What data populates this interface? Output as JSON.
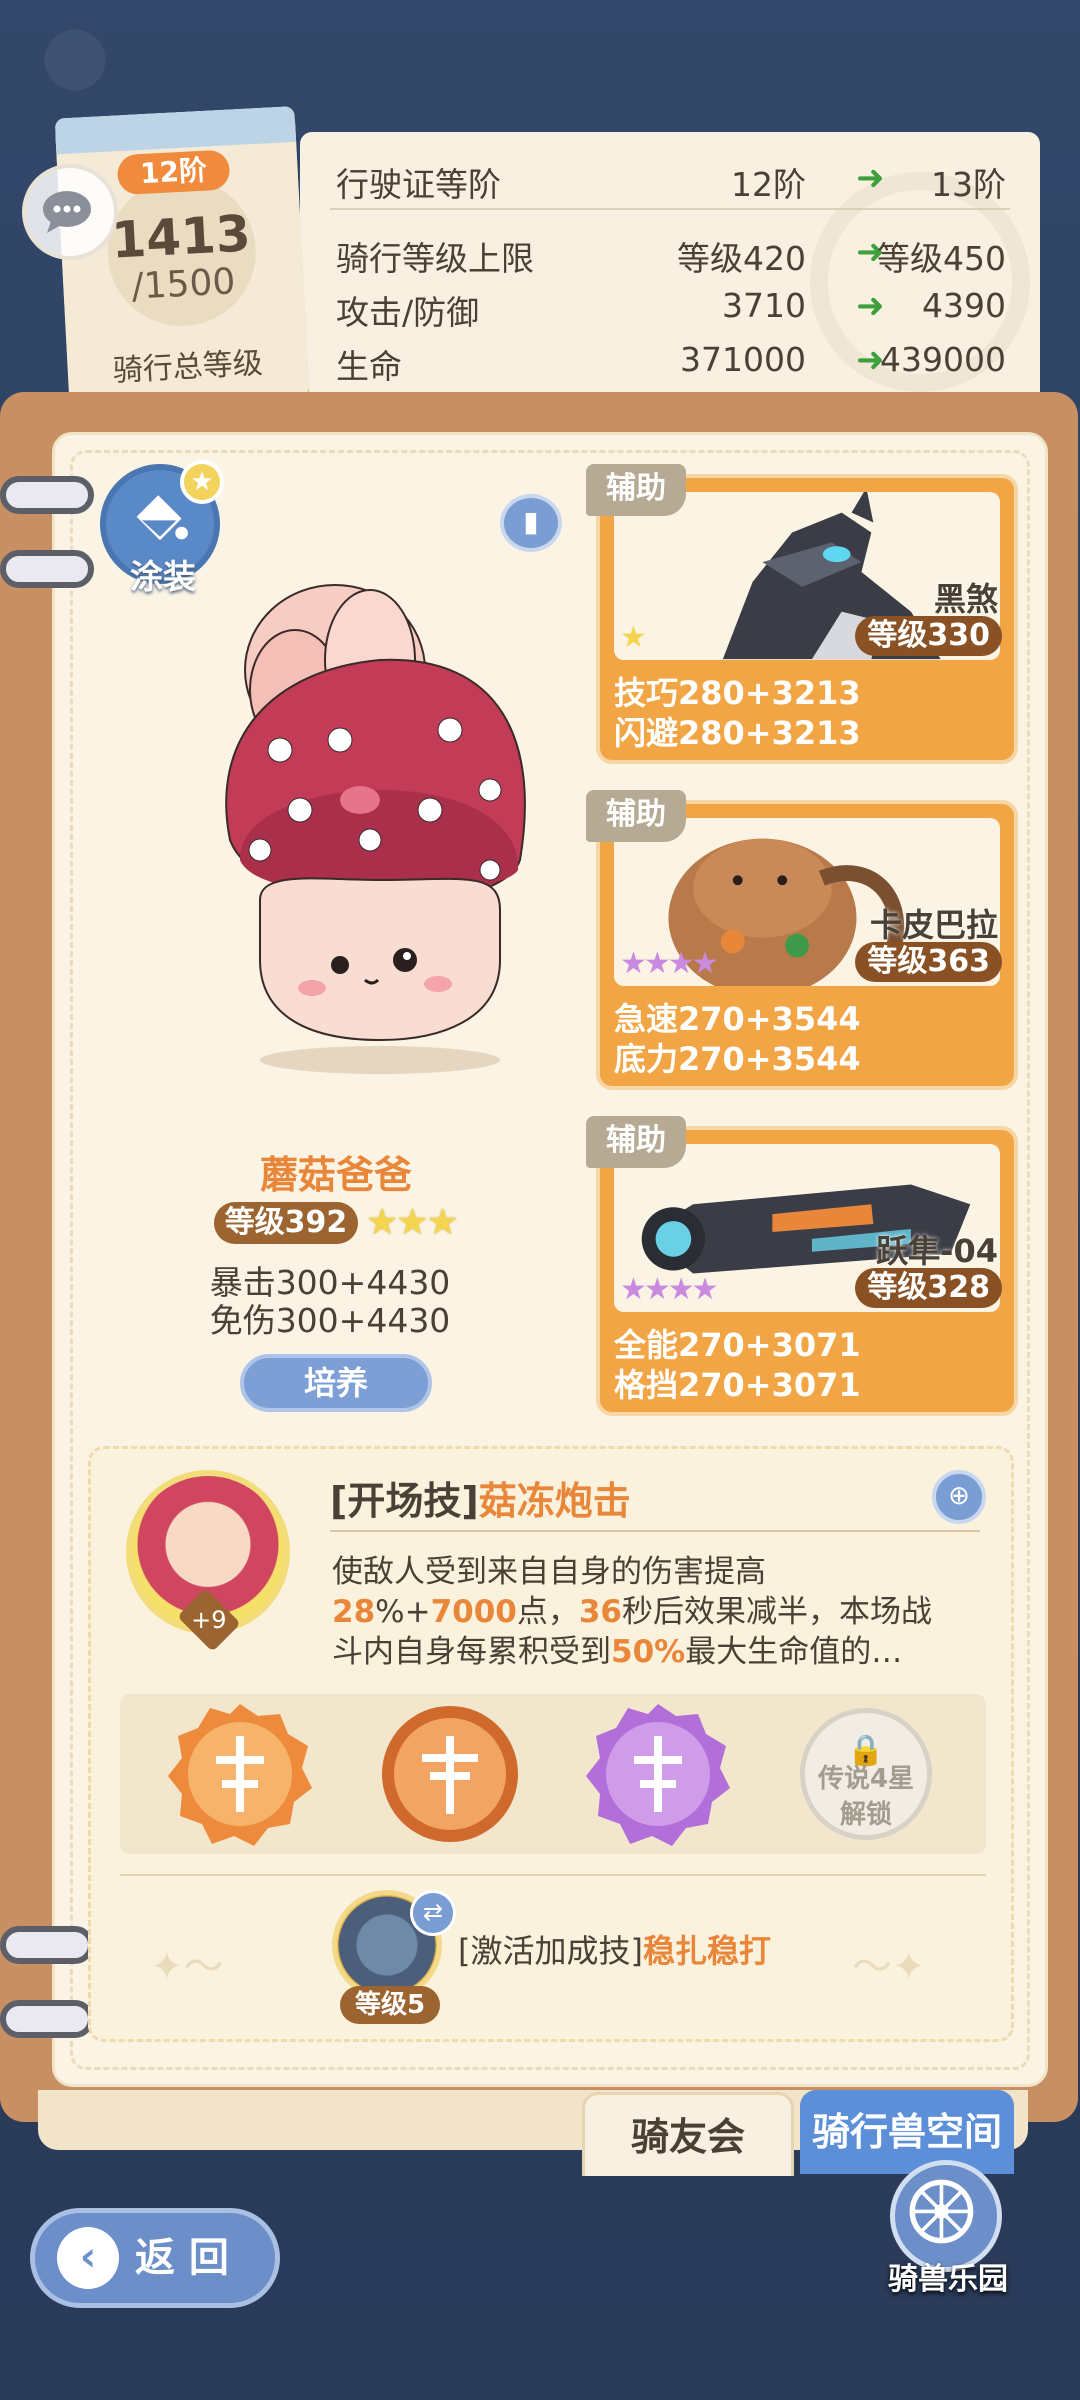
{
  "level_card": {
    "rank_badge": "12阶",
    "current_level": "1413",
    "max_level": "/1500",
    "caption": "骑行总等级"
  },
  "upgrade_table": {
    "rows": [
      {
        "label": "行驶证等阶",
        "current": "12阶",
        "next": "13阶"
      },
      {
        "label": "骑行等级上限",
        "current": "等级420",
        "next": "等级450"
      },
      {
        "label": "攻击/防御",
        "current": "3710",
        "next": "4390"
      },
      {
        "label": "生命",
        "current": "371000",
        "next": "439000"
      }
    ]
  },
  "main_mount": {
    "paint_label": "涂装",
    "name": "蘑菇爸爸",
    "level": "等级392",
    "stars": "★★★",
    "stats": [
      "暴击300+4430",
      "免伤300+4430"
    ],
    "train_label": "培养"
  },
  "helpers": [
    {
      "tag": "辅助",
      "name": "黑煞",
      "level": "等级330",
      "stars": "★",
      "stats": [
        "技巧280+3213",
        "闪避280+3213"
      ]
    },
    {
      "tag": "辅助",
      "name": "卡皮巴拉",
      "level": "等级363",
      "stars": "★★★★",
      "stats": [
        "急速270+3544",
        "底力270+3544"
      ]
    },
    {
      "tag": "辅助",
      "name": "跃隼-04",
      "level": "等级328",
      "stars": "★★★★",
      "stats": [
        "全能270+3071",
        "格挡270+3071"
      ]
    }
  ],
  "skill": {
    "avatar_plus": "+9",
    "prefix": "[开场技]",
    "name": "菇冻炮击",
    "desc_line1": "使敌人受到来自自身的伤害提高",
    "desc_v1": "28",
    "desc_t1": "%+",
    "desc_v2": "7000",
    "desc_t2": "点，",
    "desc_v3": "36",
    "desc_t3": "秒后效果减半，本场战",
    "desc_t4": "斗内自身每累积受到",
    "desc_v4": "50%",
    "desc_t5": "最大生命值的…",
    "locked_rune": [
      "传说4星",
      "解锁"
    ]
  },
  "bonus_skill": {
    "level": "等级5",
    "prefix": "[激活加成技]",
    "name": "稳扎稳打"
  },
  "tabs": {
    "club": "骑友会",
    "space": "骑行兽空间"
  },
  "nav": {
    "back": "返 回",
    "park": "骑兽乐园"
  },
  "colors": {
    "accent_orange": "#e8863a",
    "helper_card": "#f2a544",
    "blue_button": "#6c8fc9",
    "upgrade_arrow": "#3ea03c"
  }
}
